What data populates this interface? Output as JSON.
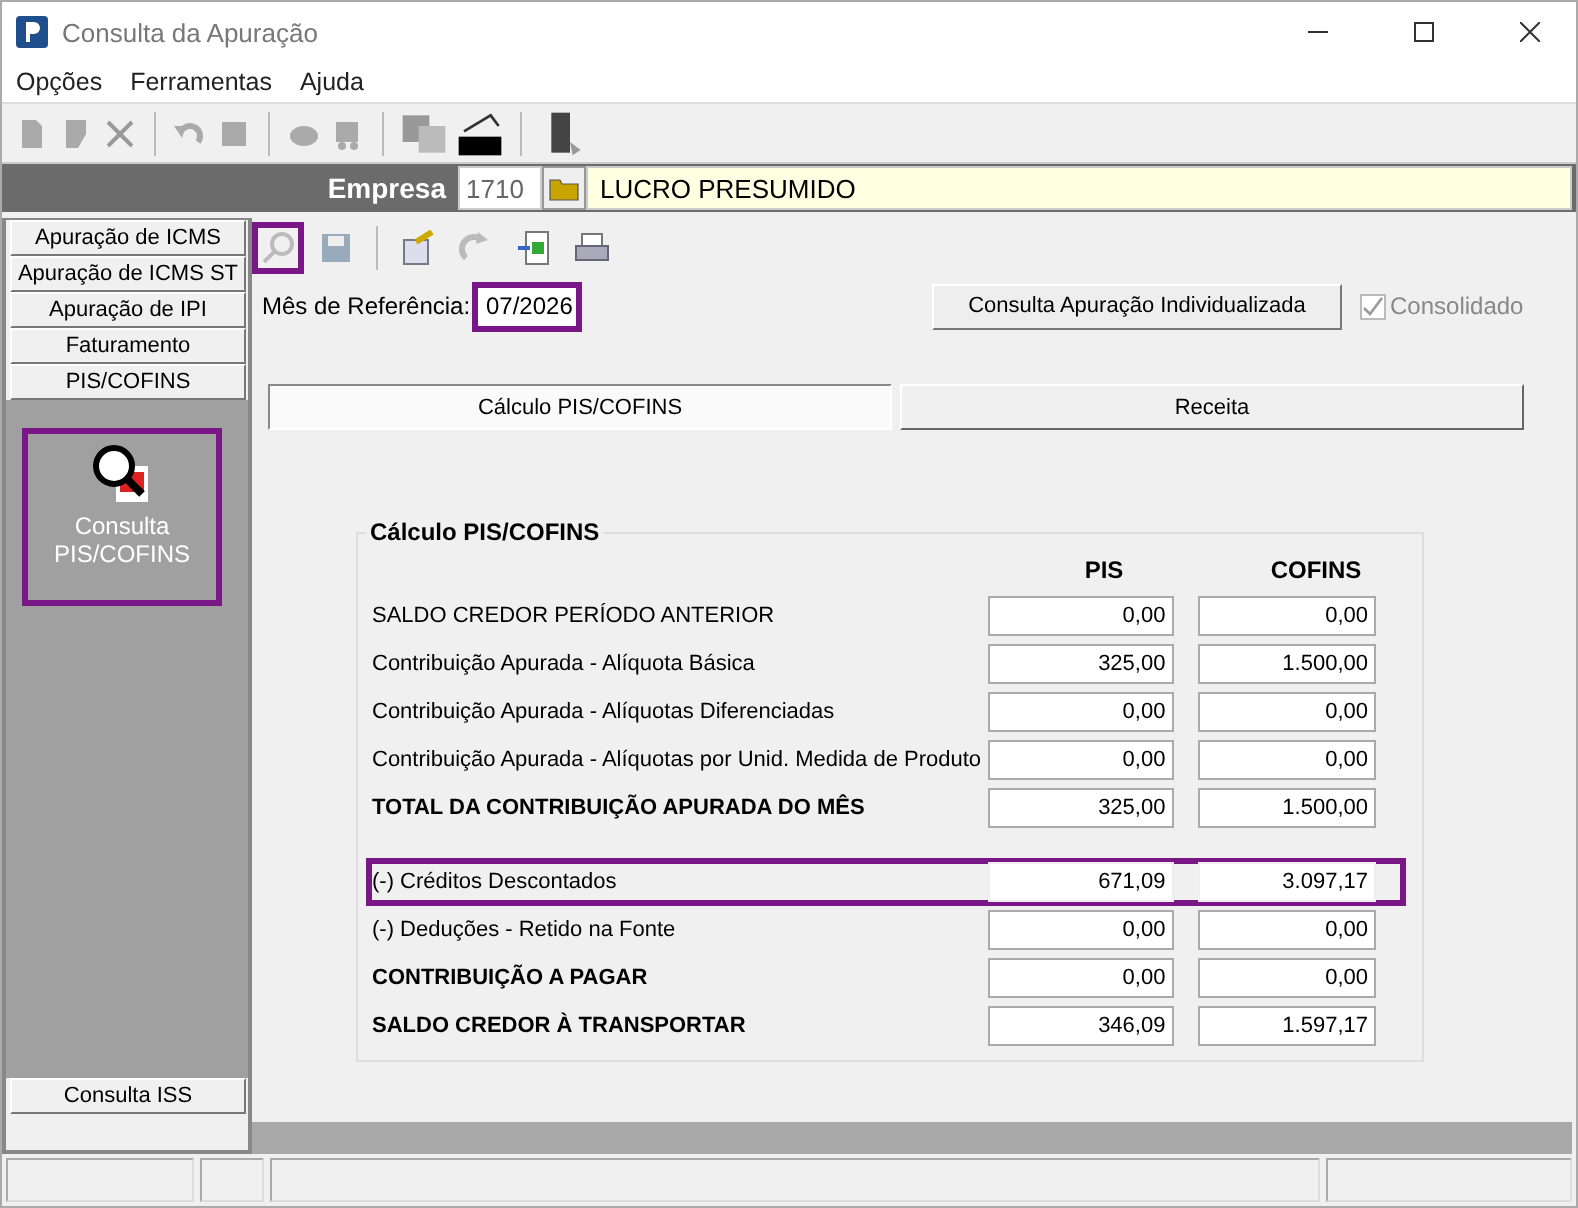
{
  "window": {
    "title": "Consulta da Apuração"
  },
  "menu": [
    "Opções",
    "Ferramentas",
    "Ajuda"
  ],
  "company": {
    "label": "Empresa",
    "code": "1710",
    "name": "LUCRO PRESUMIDO"
  },
  "sidebar": {
    "items": [
      {
        "label": "Apuração de ICMS"
      },
      {
        "label": "Apuração de ICMS ST"
      },
      {
        "label": "Apuração de IPI"
      },
      {
        "label": "Faturamento"
      },
      {
        "label": "PIS/COFINS"
      }
    ],
    "card": {
      "label": "Consulta PIS/COFINS",
      "highlighted": true
    },
    "bottom_item": {
      "label": "Consulta ISS"
    }
  },
  "search_tool": {
    "highlighted": true
  },
  "reference_month": {
    "label": "Mês de Referência:",
    "value": "07/2026",
    "highlighted": true
  },
  "individual_button": "Consulta Apuração Individualizada",
  "consolidated": {
    "label": "Consolidado",
    "checked": true,
    "disabled": true
  },
  "tabs": [
    {
      "label": "Cálculo PIS/COFINS",
      "selected": true
    },
    {
      "label": "Receita",
      "selected": false
    }
  ],
  "group": {
    "title": "Cálculo PIS/COFINS",
    "columns": [
      "PIS",
      "COFINS"
    ],
    "blocks": [
      {
        "rows": [
          {
            "label": "SALDO CREDOR PERÍODO ANTERIOR",
            "bold": false,
            "highlighted": false,
            "pis": "0,00",
            "cofins": "0,00"
          },
          {
            "label": "Contribuição Apurada - Alíquota Básica",
            "bold": false,
            "highlighted": false,
            "pis": "325,00",
            "cofins": "1.500,00"
          },
          {
            "label": "Contribuição Apurada - Alíquotas Diferenciadas",
            "bold": false,
            "highlighted": false,
            "pis": "0,00",
            "cofins": "0,00"
          },
          {
            "label": "Contribuição Apurada - Alíquotas por Unid. Medida de Produto",
            "bold": false,
            "highlighted": false,
            "pis": "0,00",
            "cofins": "0,00"
          },
          {
            "label": "TOTAL DA CONTRIBUIÇÃO APURADA DO MÊS",
            "bold": true,
            "highlighted": false,
            "pis": "325,00",
            "cofins": "1.500,00"
          }
        ]
      },
      {
        "rows": [
          {
            "label": "(-) Créditos Descontados",
            "bold": false,
            "highlighted": true,
            "pis": "671,09",
            "cofins": "3.097,17"
          },
          {
            "label": "(-) Deduções - Retido na Fonte",
            "bold": false,
            "highlighted": false,
            "pis": "0,00",
            "cofins": "0,00"
          },
          {
            "label": "CONTRIBUIÇÃO A PAGAR",
            "bold": true,
            "highlighted": false,
            "pis": "0,00",
            "cofins": "0,00"
          },
          {
            "label": "SALDO CREDOR À TRANSPORTAR",
            "bold": true,
            "highlighted": false,
            "pis": "346,09",
            "cofins": "1.597,17"
          }
        ]
      }
    ]
  }
}
